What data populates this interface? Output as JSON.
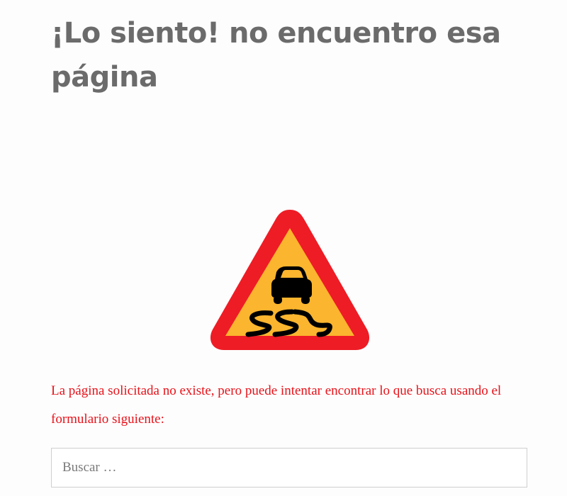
{
  "page": {
    "title": "¡Lo siento! no encuentro esa página",
    "message": "La página solicitada no existe, pero puede intentar encontrar lo que busca usando el formulario siguiente:"
  },
  "sign": {
    "icon": "slippery-road-warning-sign-icon",
    "colors": {
      "border": "#ee1c25",
      "fill": "#fbb52e",
      "symbol": "#000000"
    }
  },
  "search": {
    "placeholder": "Buscar …",
    "value": ""
  }
}
